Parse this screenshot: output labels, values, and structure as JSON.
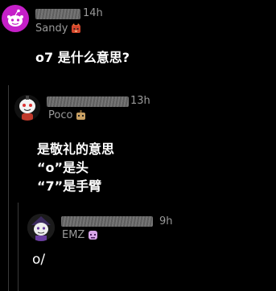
{
  "comments": [
    {
      "time": "14h",
      "username": "Sandy",
      "flair_icon": "fox-flair-icon",
      "text": "o7 是什么意思?"
    },
    {
      "time": "13h",
      "username": "Poco",
      "flair_icon": "robot-flair-icon",
      "lines": [
        "是敬礼的意思",
        "“o”是头",
        "“7”是手臂"
      ]
    },
    {
      "time": "9h",
      "username": "EMZ",
      "flair_icon": "zombie-flair-icon",
      "text": "o/"
    }
  ],
  "colors": {
    "background": "#000000",
    "text": "#ffffff",
    "meta": "#9a9a9a",
    "thread_line": "#3a3a3a",
    "sandy_avatar": "#c51fc8"
  }
}
